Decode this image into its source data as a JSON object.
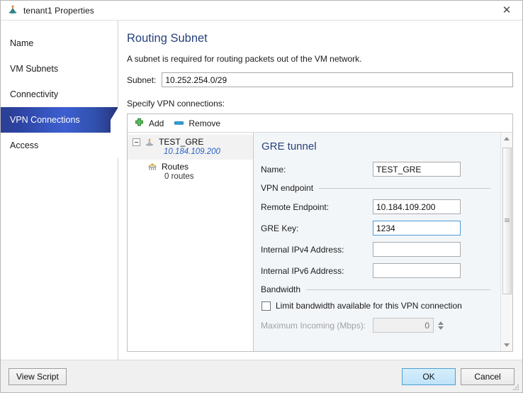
{
  "window": {
    "title": "tenant1 Properties",
    "icon": "network-tenant-icon",
    "close_label": "✕"
  },
  "sidebar": {
    "items": [
      {
        "label": "Name",
        "selected": false
      },
      {
        "label": "VM Subnets",
        "selected": false
      },
      {
        "label": "Connectivity",
        "selected": false
      },
      {
        "label": "VPN Connections",
        "selected": true
      },
      {
        "label": "Access",
        "selected": false
      }
    ]
  },
  "content": {
    "page_title": "Routing Subnet",
    "description": "A subnet is required for routing packets out of the VM network.",
    "subnet_label": "Subnet:",
    "subnet_value": "10.252.254.0/29",
    "subnet_placeholder": "",
    "specify_label": "Specify VPN connections:"
  },
  "toolbar": {
    "add_label": "Add",
    "remove_label": "Remove"
  },
  "tree": {
    "nodes": [
      {
        "title": "TEST_GRE",
        "subtitle": "10.184.109.200",
        "icon": "vpn-connection-icon",
        "selected": true,
        "expanded": true
      },
      {
        "title": "Routes",
        "subtitle": "0 routes",
        "icon": "routes-table-icon",
        "selected": false,
        "child": true
      }
    ]
  },
  "detail": {
    "title": "GRE tunnel",
    "name_label": "Name:",
    "name_value": "TEST_GRE",
    "group_endpoint": "VPN endpoint",
    "remote_label": "Remote Endpoint:",
    "remote_value": "10.184.109.200",
    "gre_key_label": "GRE Key:",
    "gre_key_value": "1234",
    "ipv4_label": "Internal IPv4 Address:",
    "ipv4_value": "",
    "ipv6_label": "Internal IPv6 Address:",
    "ipv6_value": "",
    "group_bandwidth": "Bandwidth",
    "limit_checkbox_label": "Limit bandwidth available for this VPN connection",
    "limit_checked": false,
    "max_incoming_label": "Maximum Incoming (Mbps):",
    "max_incoming_value": "0",
    "max_incoming_enabled": false
  },
  "footer": {
    "view_script_label": "View Script",
    "ok_label": "OK",
    "cancel_label": "Cancel"
  },
  "colors": {
    "accent_heading": "#28417c",
    "selected_nav": "#3756c0",
    "link_blue": "#2b5fc4",
    "add_green": "#4ca64c",
    "remove_blue": "#2ba3dd",
    "default_button": "#bfe3f8"
  }
}
